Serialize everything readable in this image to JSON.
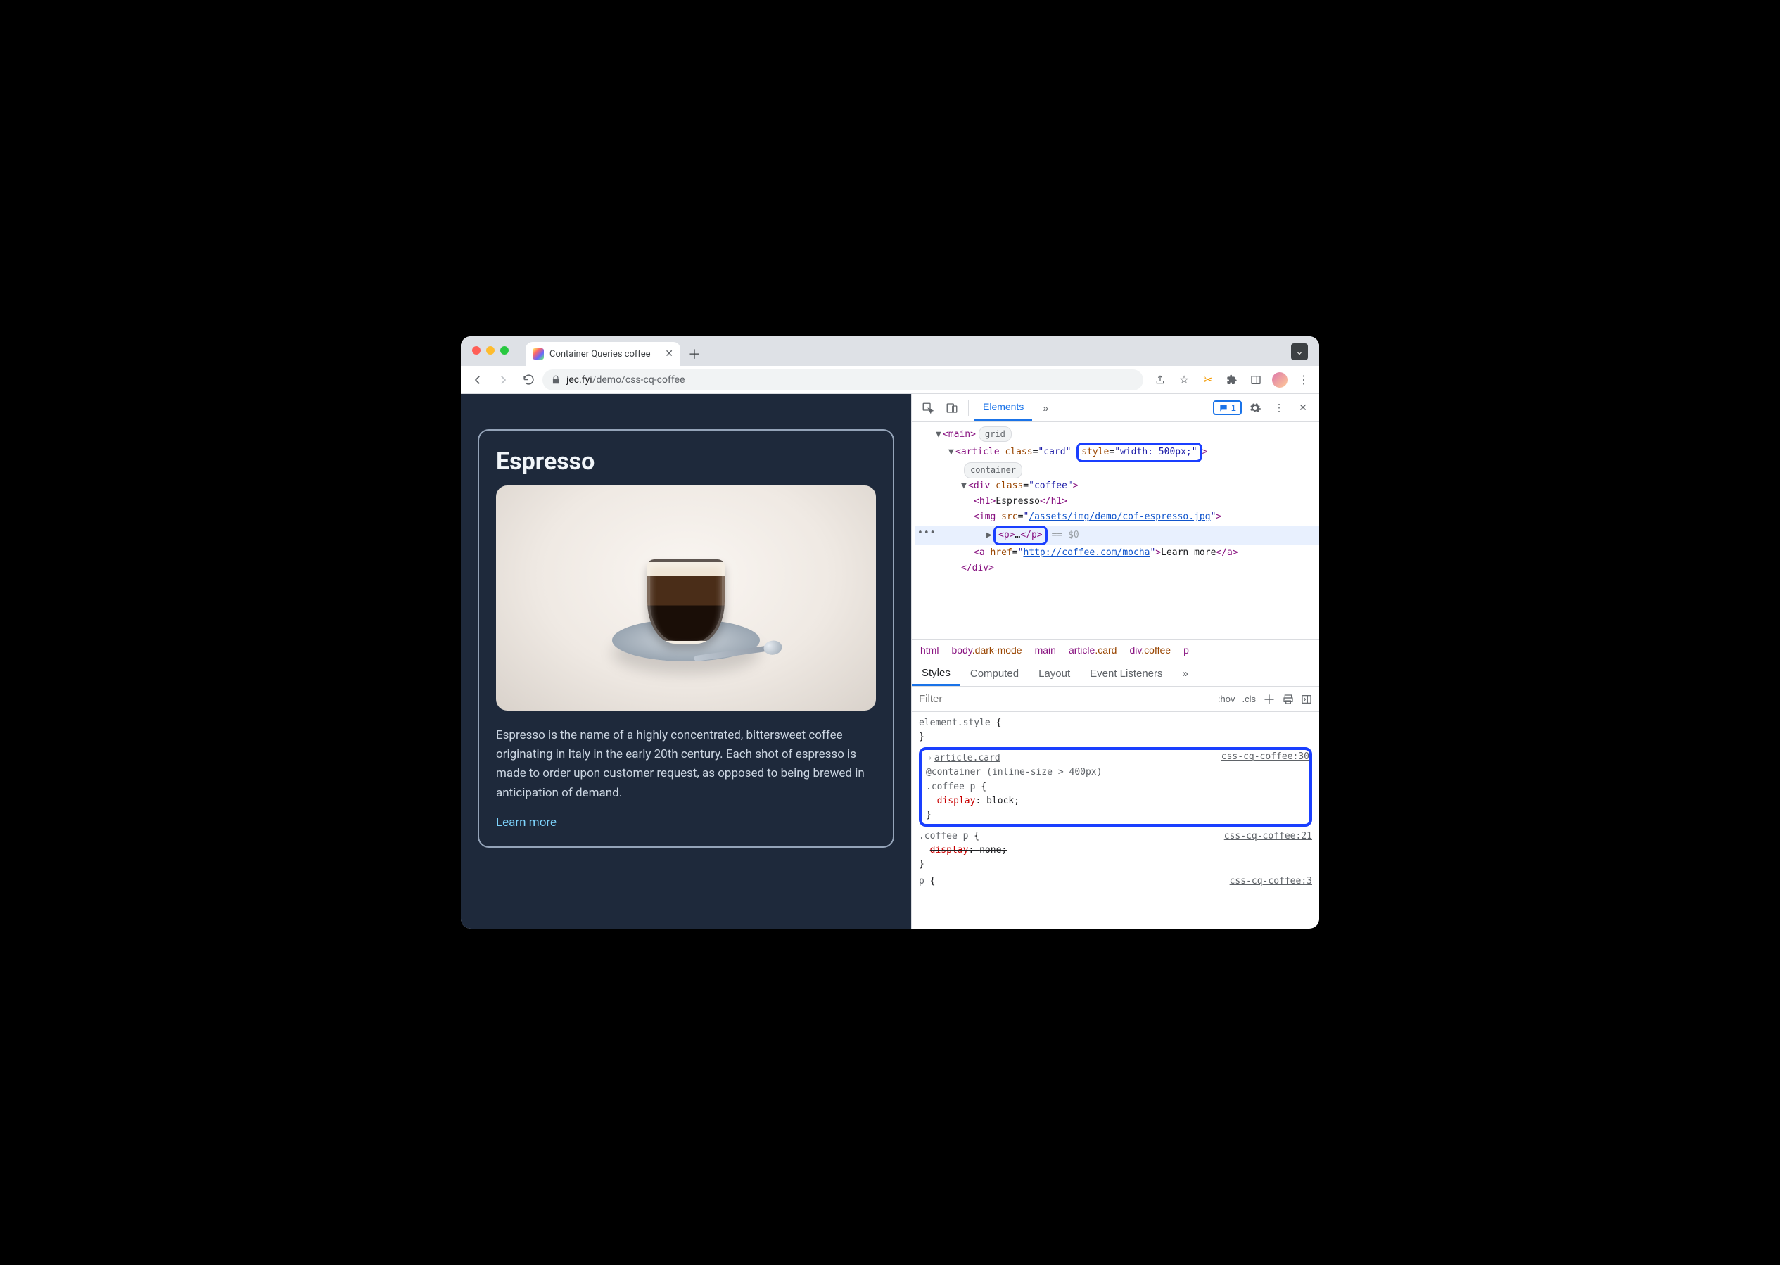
{
  "browser": {
    "tab_title": "Container Queries coffee",
    "url_host": "jec.fyi",
    "url_path": "/demo/css-cq-coffee"
  },
  "page": {
    "heading": "Espresso",
    "paragraph": "Espresso is the name of a highly concentrated, bittersweet coffee originating in Italy in the early 20th century. Each shot of espresso is made to order upon customer request, as opposed to being brewed in anticipation of demand.",
    "link_text": "Learn more"
  },
  "devtools": {
    "tabs": {
      "elements": "Elements"
    },
    "issue_count": "1",
    "elements": {
      "main_tag": "main",
      "grid_pill": "grid",
      "article_open": "article",
      "article_class_attr": "class",
      "article_class_val": "card",
      "article_style_attr": "style",
      "article_style_val": "width: 500px;",
      "container_pill": "container",
      "div_class_attr": "class",
      "div_class_val": "coffee",
      "h1_text": "Espresso",
      "img_src_attr": "src",
      "img_src_val": "/assets/img/demo/cof-espresso.jpg",
      "p_ellipsis": "…",
      "eq0": "== $0",
      "a_href_attr": "href",
      "a_href_val": "http://coffee.com/mocha",
      "a_text": "Learn more"
    },
    "crumbs": {
      "c1": "html",
      "c2a": "body",
      "c2b": ".dark-mode",
      "c3": "main",
      "c4a": "article",
      "c4b": ".card",
      "c5a": "div",
      "c5b": ".coffee",
      "c6": "p"
    },
    "styles_tabs": {
      "styles": "Styles",
      "computed": "Computed",
      "layout": "Layout",
      "listeners": "Event Listeners"
    },
    "filter": {
      "placeholder": "Filter",
      "hov": ":hov",
      "cls": ".cls"
    },
    "rules": {
      "element_style": "element.style",
      "open": "{",
      "close": "}",
      "inherit_link": "article.card",
      "container_query": "@container (inline-size > 400px)",
      "sel_coffee_p": ".coffee p",
      "display": "display",
      "block": "block",
      "none": "none",
      "sel_p": "p",
      "src1": "css-cq-coffee:30",
      "src2": "css-cq-coffee:21",
      "src3": "css-cq-coffee:3"
    }
  }
}
